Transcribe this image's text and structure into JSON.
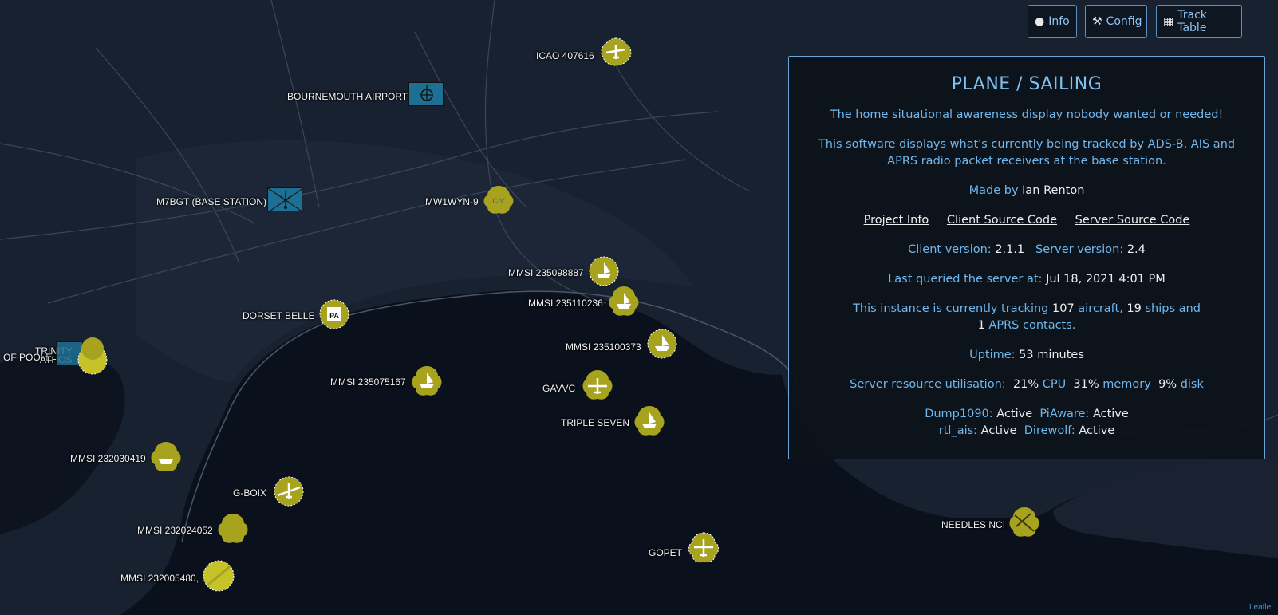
{
  "toolbar": {
    "info_label": "Info",
    "config_label": "Config",
    "track_table_label": "Track Table"
  },
  "info_panel": {
    "title": "PLANE / SAILING",
    "tagline": "The home situational awareness display nobody wanted or needed!",
    "description": "This software displays what's currently being tracked by ADS-B, AIS and APRS radio packet receivers at the base station.",
    "made_by_prefix": "Made by",
    "author": "Ian Renton",
    "links": [
      "Project Info",
      "Client Source Code",
      "Server Source Code"
    ],
    "client_version_label": "Client version:",
    "client_version": "2.1.1",
    "server_version_label": "Server version:",
    "server_version": "2.4",
    "last_queried_label": "Last queried the server at:",
    "last_queried": "Jul 18, 2021 4:01 PM",
    "tracking_prefix": "This instance is currently tracking",
    "aircraft_count": "107",
    "aircraft_label": "aircraft,",
    "ships_count": "19",
    "ships_label": "ships and",
    "aprs_count": "1",
    "aprs_label": "APRS contacts.",
    "uptime_label": "Uptime:",
    "uptime": "53 minutes",
    "resource_label": "Server resource utilisation:",
    "cpu_value": "21%",
    "cpu_label": "CPU",
    "memory_value": "31%",
    "memory_label": "memory",
    "disk_value": "9%",
    "disk_label": "disk",
    "services": [
      {
        "name": "Dump1090:",
        "status": "Active"
      },
      {
        "name": "PiAware:",
        "status": "Active"
      },
      {
        "name": "rtl_ais:",
        "status": "Active"
      },
      {
        "name": "Direwolf:",
        "status": "Active"
      }
    ]
  },
  "map_labels": {
    "icao": "ICAO 407616",
    "airport": "BOURNEMOUTH AIRPORT",
    "base_station": "M7BGT (BASE STATION)",
    "mw1wyn": "MW1WYN-9",
    "civ_marker": "CIV",
    "mmsi_235098887": "MMSI 235098887",
    "mmsi_235110236": "MMSI 235110236",
    "dorset_belle": "DORSET BELLE",
    "pa_marker": "PA",
    "mmsi_235100373": "MMSI 235100373",
    "trinity": "TRINITY",
    "athos": "ATHOS",
    "of_poole": "OF POOLE",
    "mmsi_235075167": "MMSI 235075167",
    "gavvc": "GAVVC",
    "triple_seven": "TRIPLE SEVEN",
    "mmsi_232030419": "MMSI 232030419",
    "g_boix": "G-BOIX",
    "mmsi_232024052": "MMSI 232024052",
    "mmsi_overlap": "MMSI 232005480,",
    "needles": "NEEDLES NCI",
    "gopet": "GOPET"
  },
  "attribution": "Leaflet",
  "colors": {
    "marker_fill": "#a8a31e",
    "panel_text": "#6fb7ee",
    "panel_border": "#6aa3d8",
    "facility_fill": "#1e6f94"
  },
  "icons": [
    "info-icon",
    "config-icon",
    "track-table-icon"
  ]
}
